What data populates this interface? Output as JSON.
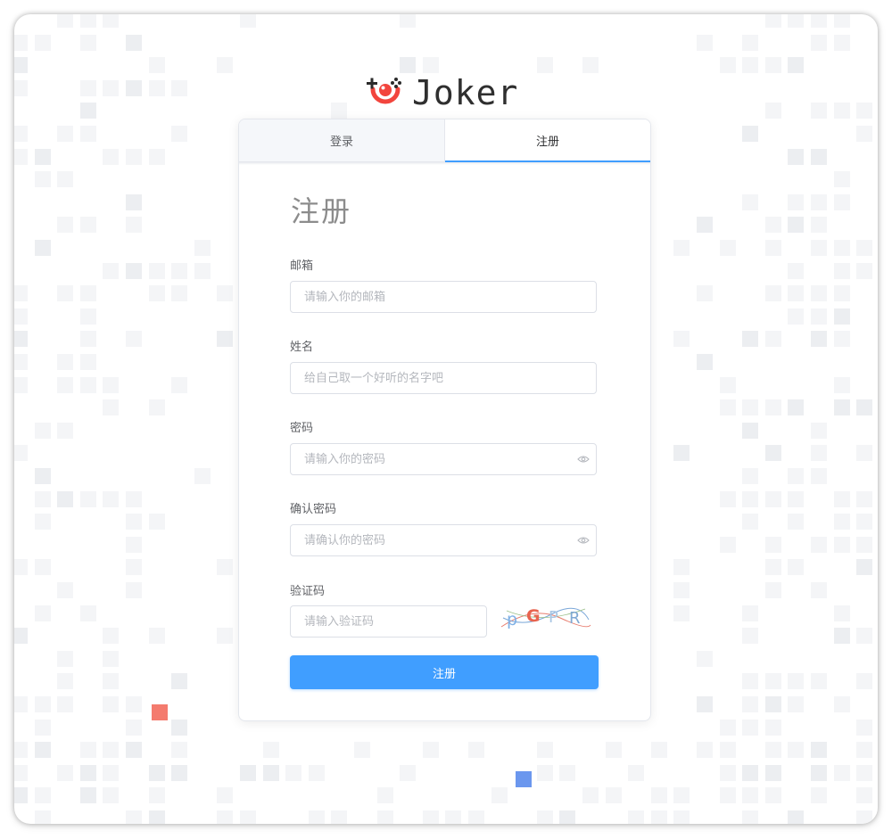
{
  "app": {
    "logo_text": "Joker",
    "icon": "clown-gamepad-icon",
    "brand_color": "#f2453d"
  },
  "tabs": [
    {
      "label": "登录",
      "active": false
    },
    {
      "label": "注册",
      "active": true
    }
  ],
  "form": {
    "title": "注册",
    "email": {
      "label": "邮箱",
      "placeholder": "请输入你的邮箱",
      "value": ""
    },
    "name": {
      "label": "姓名",
      "placeholder": "给自己取一个好听的名字吧",
      "value": ""
    },
    "password": {
      "label": "密码",
      "placeholder": "请输入你的密码",
      "value": "",
      "icon": "eye-icon"
    },
    "confirm": {
      "label": "确认密码",
      "placeholder": "请确认你的密码",
      "value": "",
      "icon": "eye-icon"
    },
    "captcha": {
      "label": "验证码",
      "placeholder": "请输入验证码",
      "value": "",
      "image_chars": [
        "p",
        "G",
        "P",
        "R"
      ]
    },
    "submit_label": "注册"
  },
  "colors": {
    "accent": "#409eff",
    "tile_light": "#f4f5f7",
    "tile_red": "#f47b6e",
    "tile_blue": "#6b97ee"
  }
}
